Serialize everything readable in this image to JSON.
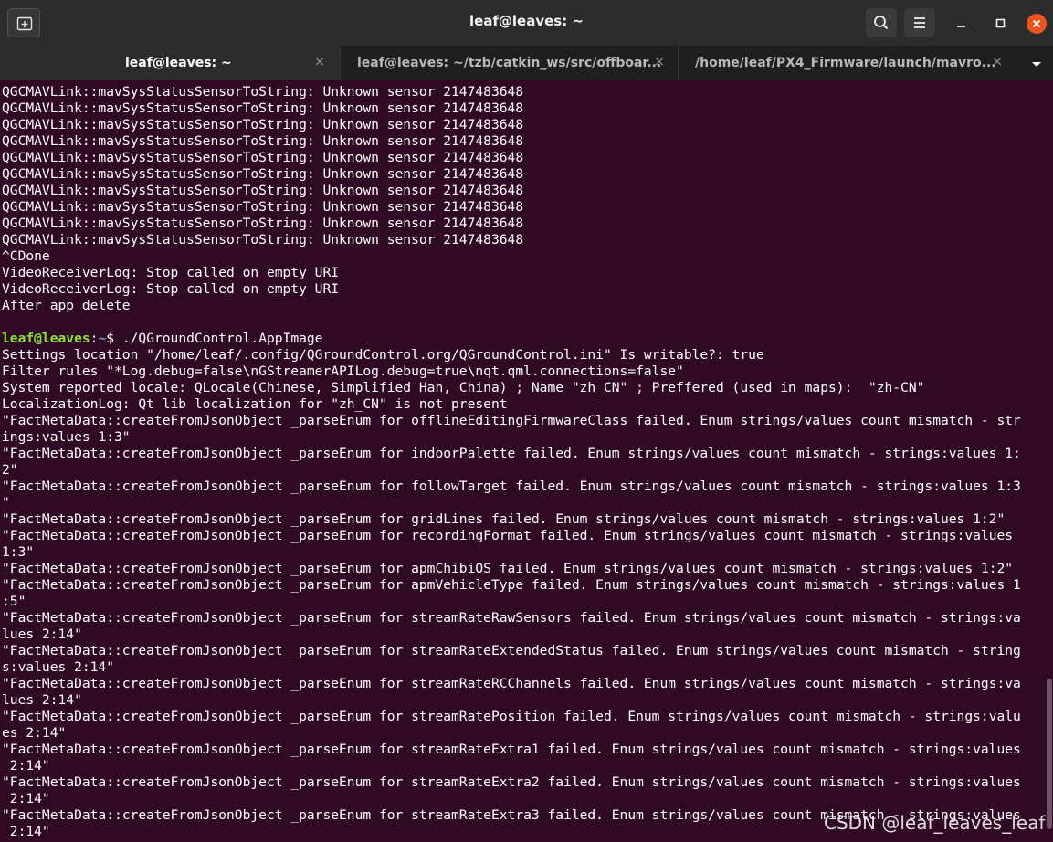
{
  "window": {
    "title": "leaf@leaves: ~"
  },
  "tabs": [
    {
      "label": "leaf@leaves: ~",
      "active": true,
      "close": "×"
    },
    {
      "label": "leaf@leaves: ~/tzb/catkin_ws/src/offboar...",
      "active": false,
      "close": "×"
    },
    {
      "label": "/home/leaf/PX4_Firmware/launch/mavro...",
      "active": false,
      "close": "×"
    }
  ],
  "icons": {
    "new_tab": "new-tab-icon",
    "search": "search-icon",
    "menu": "hamburger-menu-icon",
    "minimize": "minimize-icon",
    "maximize": "maximize-icon",
    "close": "close-icon",
    "tabs_dropdown": "chevron-down-icon"
  },
  "colors": {
    "terminal_bg": "#300a24",
    "prompt_user": "#8ae234",
    "prompt_path": "#729fcf",
    "close_button": "#e95420"
  },
  "terminal": {
    "prompt": {
      "user": "leaf@leaves",
      "sep": ":",
      "path": "~",
      "symbol": "$",
      "command": " ./QGroundControl.AppImage"
    },
    "lines_before": [
      "QGCMAVLink::mavSysStatusSensorToString: Unknown sensor 2147483648",
      "QGCMAVLink::mavSysStatusSensorToString: Unknown sensor 2147483648",
      "QGCMAVLink::mavSysStatusSensorToString: Unknown sensor 2147483648",
      "QGCMAVLink::mavSysStatusSensorToString: Unknown sensor 2147483648",
      "QGCMAVLink::mavSysStatusSensorToString: Unknown sensor 2147483648",
      "QGCMAVLink::mavSysStatusSensorToString: Unknown sensor 2147483648",
      "QGCMAVLink::mavSysStatusSensorToString: Unknown sensor 2147483648",
      "QGCMAVLink::mavSysStatusSensorToString: Unknown sensor 2147483648",
      "QGCMAVLink::mavSysStatusSensorToString: Unknown sensor 2147483648",
      "QGCMAVLink::mavSysStatusSensorToString: Unknown sensor 2147483648",
      "^CDone",
      "VideoReceiverLog: Stop called on empty URI",
      "VideoReceiverLog: Stop called on empty URI",
      "After app delete",
      ""
    ],
    "lines_after": [
      "Settings location \"/home/leaf/.config/QGroundControl.org/QGroundControl.ini\" Is writable?: true",
      "Filter rules \"*Log.debug=false\\nGStreamerAPILog.debug=true\\nqt.qml.connections=false\"",
      "System reported locale: QLocale(Chinese, Simplified Han, China) ; Name \"zh_CN\" ; Preffered (used in maps):  \"zh-CN\"",
      "LocalizationLog: Qt lib localization for \"zh_CN\" is not present",
      "\"FactMetaData::createFromJsonObject _parseEnum for offlineEditingFirmwareClass failed. Enum strings/values count mismatch - str",
      "ings:values 1:3\"",
      "\"FactMetaData::createFromJsonObject _parseEnum for indoorPalette failed. Enum strings/values count mismatch - strings:values 1:",
      "2\"",
      "\"FactMetaData::createFromJsonObject _parseEnum for followTarget failed. Enum strings/values count mismatch - strings:values 1:3",
      "\"",
      "\"FactMetaData::createFromJsonObject _parseEnum for gridLines failed. Enum strings/values count mismatch - strings:values 1:2\"",
      "\"FactMetaData::createFromJsonObject _parseEnum for recordingFormat failed. Enum strings/values count mismatch - strings:values",
      "1:3\"",
      "\"FactMetaData::createFromJsonObject _parseEnum for apmChibiOS failed. Enum strings/values count mismatch - strings:values 1:2\"",
      "\"FactMetaData::createFromJsonObject _parseEnum for apmVehicleType failed. Enum strings/values count mismatch - strings:values 1",
      ":5\"",
      "\"FactMetaData::createFromJsonObject _parseEnum for streamRateRawSensors failed. Enum strings/values count mismatch - strings:va",
      "lues 2:14\"",
      "\"FactMetaData::createFromJsonObject _parseEnum for streamRateExtendedStatus failed. Enum strings/values count mismatch - string",
      "s:values 2:14\"",
      "\"FactMetaData::createFromJsonObject _parseEnum for streamRateRCChannels failed. Enum strings/values count mismatch - strings:va",
      "lues 2:14\"",
      "\"FactMetaData::createFromJsonObject _parseEnum for streamRatePosition failed. Enum strings/values count mismatch - strings:valu",
      "es 2:14\"",
      "\"FactMetaData::createFromJsonObject _parseEnum for streamRateExtra1 failed. Enum strings/values count mismatch - strings:values",
      " 2:14\"",
      "\"FactMetaData::createFromJsonObject _parseEnum for streamRateExtra2 failed. Enum strings/values count mismatch - strings:values",
      " 2:14\"",
      "\"FactMetaData::createFromJsonObject _parseEnum for streamRateExtra3 failed. Enum strings/values count mismatch - strings:values",
      " 2:14\""
    ]
  },
  "watermark": "CSDN @leaf_leaves_leaf"
}
